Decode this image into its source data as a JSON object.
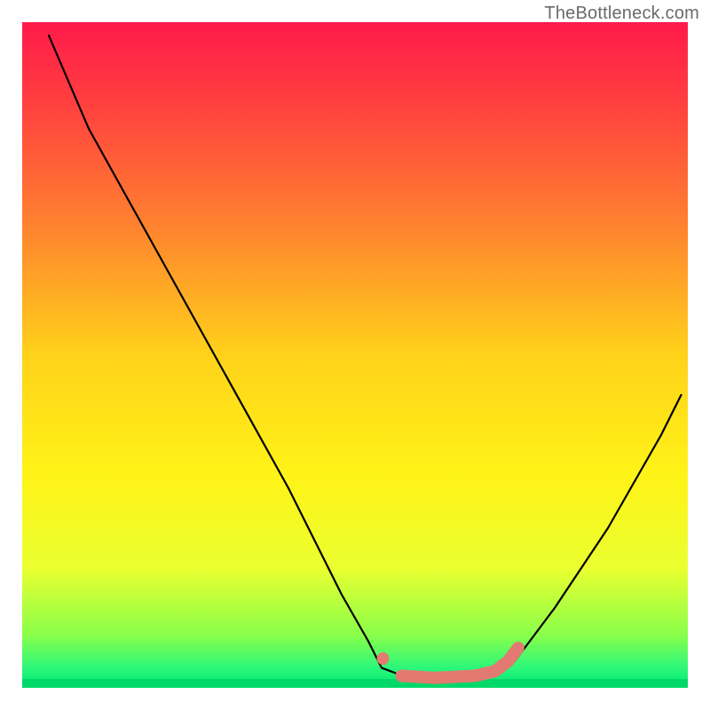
{
  "attribution": "TheBottleneck.com",
  "chart_data": {
    "type": "line",
    "title": "",
    "xlabel": "",
    "ylabel": "",
    "x_range": [
      0,
      100
    ],
    "y_range": [
      0,
      100
    ],
    "gradient_stops": [
      {
        "offset": 0.0,
        "color": "#ff1a4a"
      },
      {
        "offset": 0.12,
        "color": "#ff3f3f"
      },
      {
        "offset": 0.3,
        "color": "#ff8030"
      },
      {
        "offset": 0.5,
        "color": "#ffd21a"
      },
      {
        "offset": 0.68,
        "color": "#fff317"
      },
      {
        "offset": 0.82,
        "color": "#eaff30"
      },
      {
        "offset": 0.92,
        "color": "#8aff4a"
      },
      {
        "offset": 0.97,
        "color": "#2cf77a"
      },
      {
        "offset": 1.0,
        "color": "#00e874"
      }
    ],
    "series": [
      {
        "name": "bottleneck-curve",
        "color": "#000000",
        "points": [
          {
            "x": 4.0,
            "y": 98.0
          },
          {
            "x": 10.0,
            "y": 84.0
          },
          {
            "x": 20.0,
            "y": 66.0
          },
          {
            "x": 30.0,
            "y": 48.0
          },
          {
            "x": 40.0,
            "y": 30.0
          },
          {
            "x": 48.0,
            "y": 14.0
          },
          {
            "x": 52.0,
            "y": 7.0
          },
          {
            "x": 54.0,
            "y": 3.0
          },
          {
            "x": 58.0,
            "y": 1.5
          },
          {
            "x": 64.0,
            "y": 1.5
          },
          {
            "x": 70.0,
            "y": 2.0
          },
          {
            "x": 74.0,
            "y": 4.0
          },
          {
            "x": 80.0,
            "y": 12.0
          },
          {
            "x": 88.0,
            "y": 24.0
          },
          {
            "x": 96.0,
            "y": 38.0
          },
          {
            "x": 99.0,
            "y": 44.0
          }
        ]
      },
      {
        "name": "highlight-dot",
        "color": "#e37a72",
        "points": [
          {
            "x": 54.2,
            "y": 4.4
          }
        ]
      },
      {
        "name": "highlight-segment",
        "color": "#e37a72",
        "points": [
          {
            "x": 57.0,
            "y": 1.8
          },
          {
            "x": 62.0,
            "y": 1.5
          },
          {
            "x": 68.0,
            "y": 1.8
          },
          {
            "x": 71.0,
            "y": 2.5
          },
          {
            "x": 73.0,
            "y": 4.0
          },
          {
            "x": 74.5,
            "y": 6.0
          }
        ]
      }
    ]
  }
}
